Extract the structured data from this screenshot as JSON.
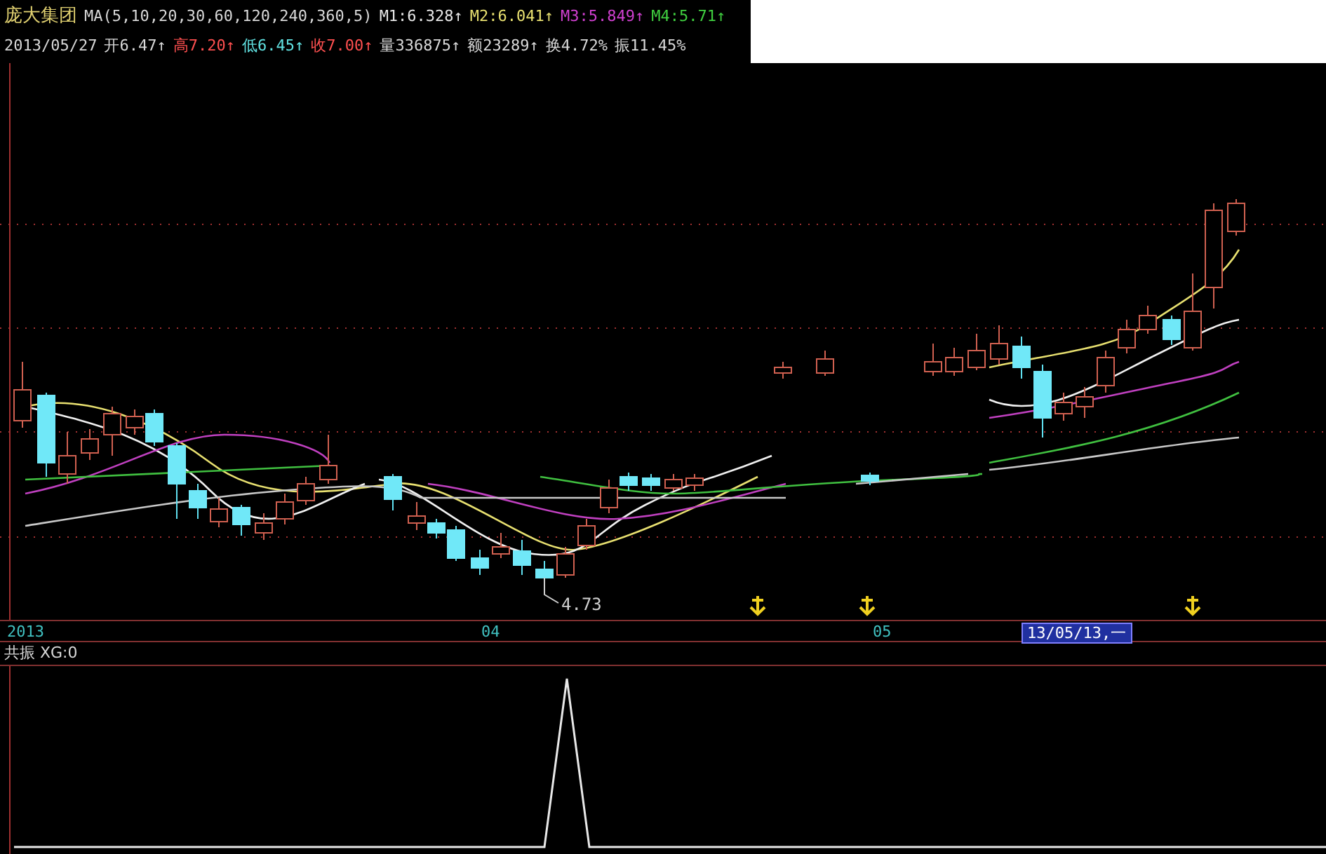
{
  "security": {
    "name": "庞大集团"
  },
  "ma_legend": {
    "params": "MA(5,10,20,30,60,120,240,360,5)",
    "values": [
      {
        "text": "M1:6.328↑",
        "color": "#e8e8e8"
      },
      {
        "text": "M2:6.041↑",
        "color": "#e8e070"
      },
      {
        "text": "M3:5.849↑",
        "color": "#d040d0"
      },
      {
        "text": "M4:5.71↑",
        "color": "#40d040"
      }
    ]
  },
  "quote": {
    "date": "2013/05/27",
    "fields": [
      {
        "text": "开6.47↑",
        "color": "#d8d8d8"
      },
      {
        "text": "高7.20↑",
        "color": "#ff5050"
      },
      {
        "text": "低6.45↑",
        "color": "#60e0e0"
      },
      {
        "text": "收7.00↑",
        "color": "#ff5050"
      },
      {
        "text": "量336875↑",
        "color": "#d8d8d8"
      },
      {
        "text": "额23289↑",
        "color": "#d8d8d8"
      },
      {
        "text": "换4.72%",
        "color": "#d8d8d8"
      },
      {
        "text": "振11.45%",
        "color": "#d8d8d8"
      }
    ]
  },
  "chart": {
    "low_label": "4.73"
  },
  "time_axis": {
    "labels": [
      "2013",
      "04",
      "05"
    ],
    "cursor": "13/05/13,一"
  },
  "indicator": {
    "title": "共振 XG:0"
  }
}
